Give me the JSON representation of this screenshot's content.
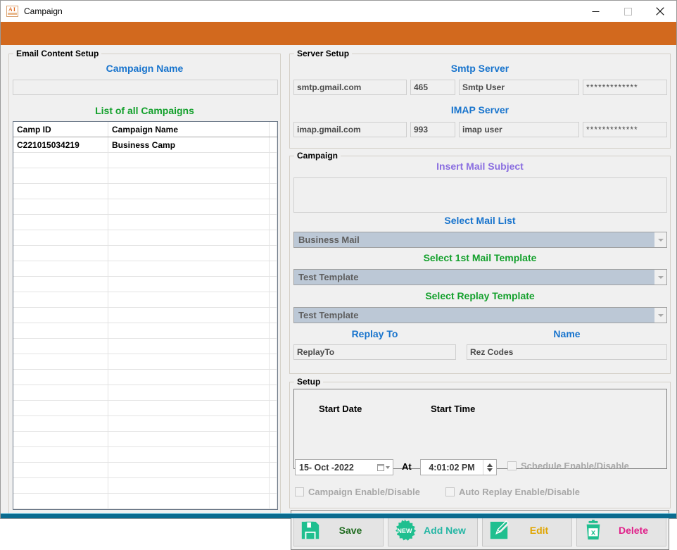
{
  "window": {
    "title": "Campaign",
    "icon_letters": "AI",
    "banner_color": "#d2691e",
    "accent_color": "#0a6b8f",
    "minimize_label": "Minimize",
    "maximize_label": "Maximize",
    "close_label": "Close"
  },
  "left_panel": {
    "group_title": "Email Content Setup",
    "campaign_name_heading": "Campaign Name",
    "campaign_name_value": "",
    "campaign_name_placeholder": "",
    "list_heading": "List of all Campaigns",
    "grid": {
      "columns": [
        "Camp ID",
        "Campaign Name",
        ""
      ],
      "rows": [
        [
          "C221015034219",
          "Business Camp",
          ""
        ]
      ],
      "empty_row_count": 24
    }
  },
  "server_setup": {
    "group_title": "Server Setup",
    "smtp_heading": "Smtp Server",
    "smtp_host": "smtp.gmail.com",
    "smtp_port": "465",
    "smtp_user": "Smtp User",
    "smtp_password": "*************",
    "imap_heading": "IMAP Server",
    "imap_host": "imap.gmail.com",
    "imap_port": "993",
    "imap_user": "imap user",
    "imap_password": "*************"
  },
  "campaign": {
    "group_title": "Campaign",
    "subject_heading": "Insert Mail Subject",
    "subject_value": "",
    "mail_list_heading": "Select Mail List",
    "mail_list_value": "Business Mail",
    "first_template_heading": "Select 1st Mail Template",
    "first_template_value": "Test Template",
    "replay_template_heading": "Select Replay Template",
    "replay_template_value": "Test Template",
    "replay_to_heading": "Replay To",
    "replay_to_value": "ReplayTo",
    "name_heading": "Name",
    "name_value": "Rez Codes"
  },
  "setup": {
    "group_title": "Setup",
    "start_date_label": "Start Date",
    "start_time_label": "Start Time",
    "start_date_value": "15- Oct -2022",
    "at_label": "At",
    "start_time_value": "4:01:02 PM",
    "schedule_checkbox": "Schedule Enable/Disable",
    "campaign_checkbox": "Campaign Enable/Disable",
    "auto_replay_checkbox": "Auto Replay Enable/Disable"
  },
  "buttons": {
    "save": {
      "label": "Save",
      "icon": "floppy-disk-icon",
      "color": "#1f6b1f"
    },
    "add_new": {
      "label": "Add New",
      "icon": "new-starburst-icon",
      "color": "#26b6a4"
    },
    "edit": {
      "label": "Edit",
      "icon": "pencil-edit-icon",
      "color": "#e0a500"
    },
    "delete": {
      "label": "Delete",
      "icon": "trash-x-icon",
      "color": "#e0218a"
    }
  }
}
